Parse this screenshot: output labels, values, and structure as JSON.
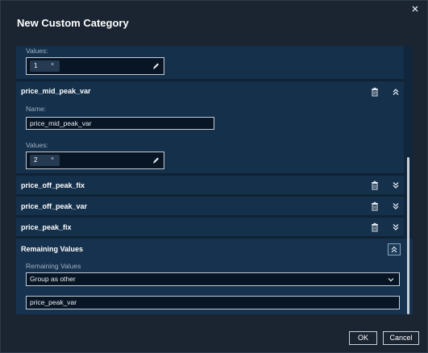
{
  "dialog": {
    "title": "New Custom Category",
    "close_icon": "close-icon"
  },
  "category_prev": {
    "values_label": "Values:",
    "chip_value": "1",
    "chip_remove": "×"
  },
  "category_mid_peak_var": {
    "title": "price_mid_peak_var",
    "name_label": "Name:",
    "name_value": "price_mid_peak_var",
    "values_label": "Values:",
    "chip_value": "2",
    "chip_remove": "×"
  },
  "categories_collapsed": [
    {
      "title": "price_off_peak_fix"
    },
    {
      "title": "price_off_peak_var"
    },
    {
      "title": "price_peak_fix"
    }
  ],
  "remaining": {
    "title": "Remaining Values",
    "label": "Remaining Values",
    "selected_option": "Group as other",
    "value_field": "price_peak_var"
  },
  "footer": {
    "ok_label": "OK",
    "cancel_label": "Cancel"
  },
  "colors": {
    "dialog_bg": "#1b2431",
    "panel_bg": "#15304b",
    "input_bg": "#081524",
    "accent_border": "#c2ccd8"
  }
}
